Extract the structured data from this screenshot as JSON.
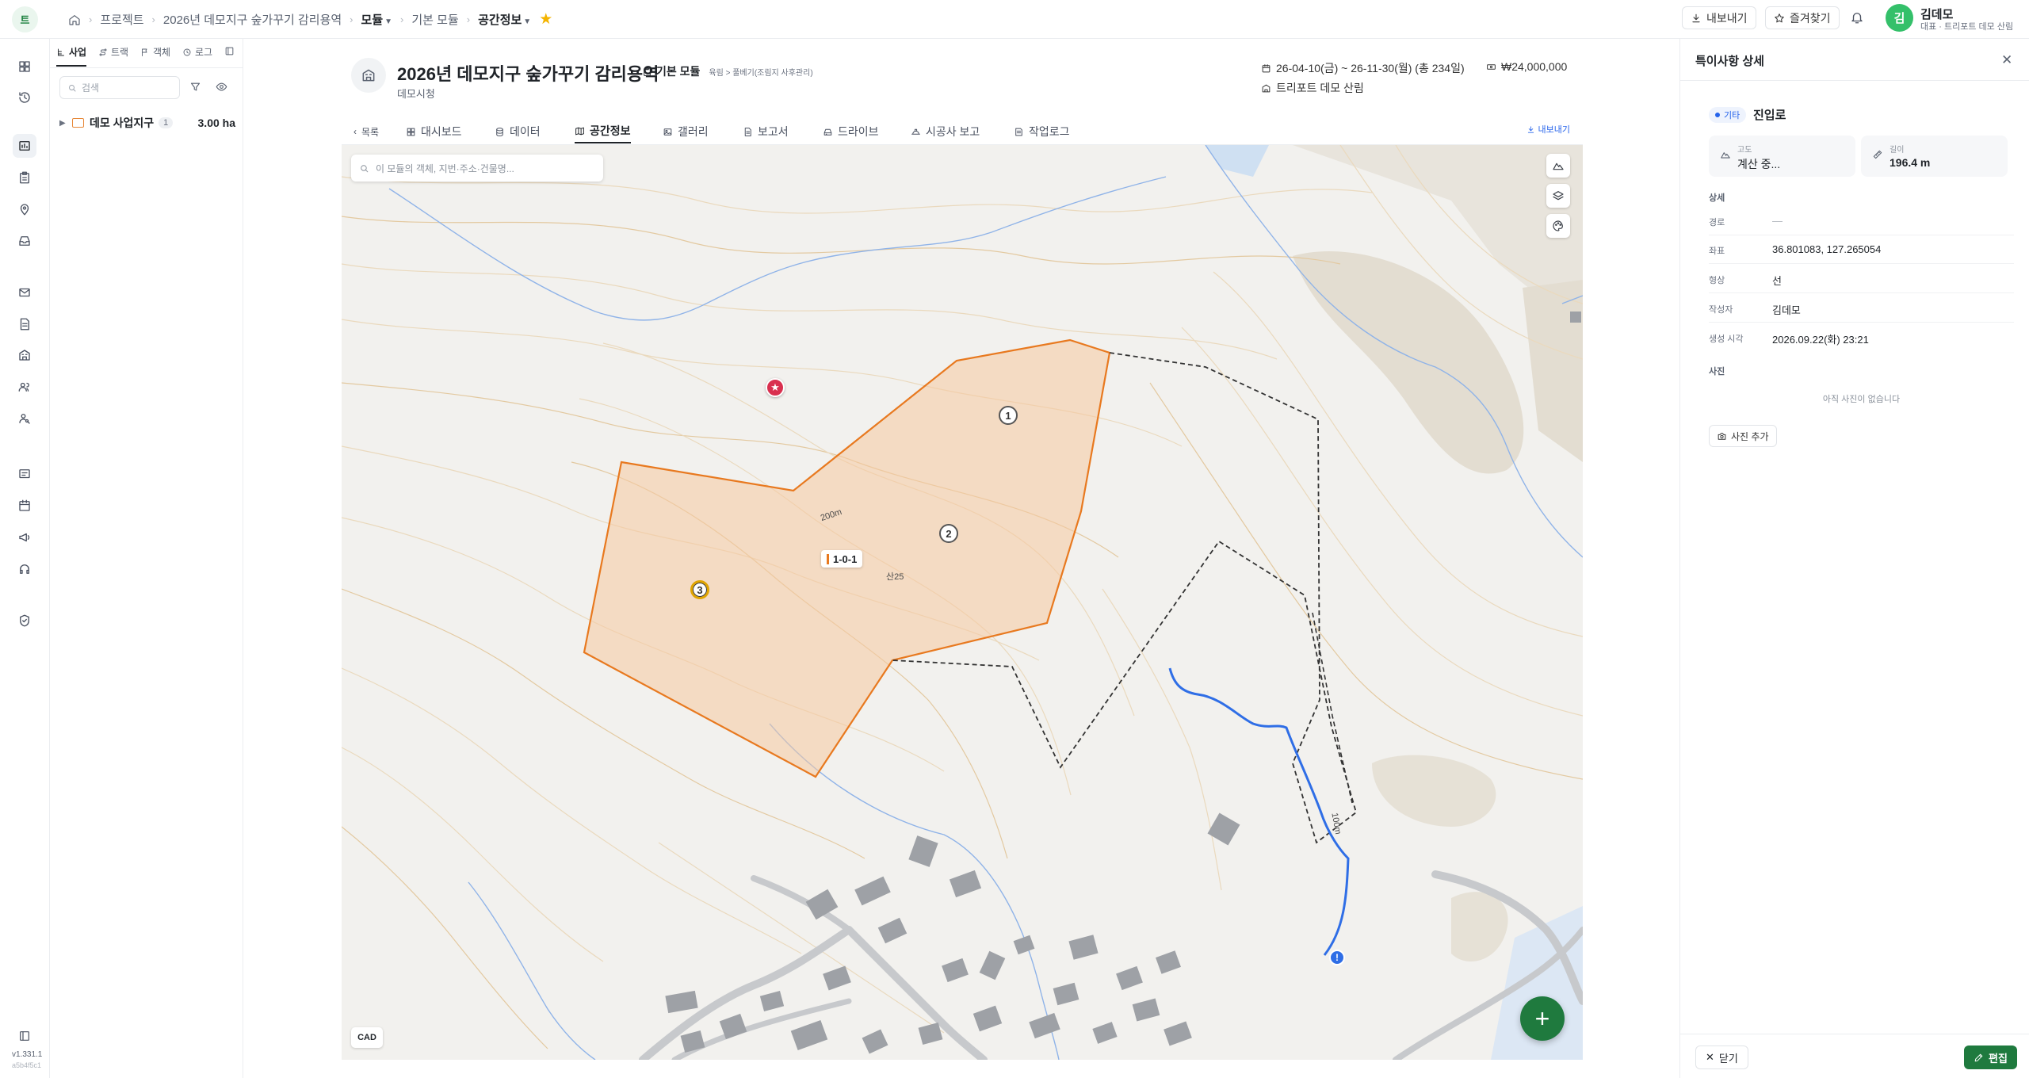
{
  "header": {
    "brand_initial": "트",
    "breadcrumb": [
      "프로젝트",
      "2026년 데모지구 숲가꾸기 감리용역",
      "모듈",
      "기본 모듈",
      "공간정보"
    ],
    "export_label": "내보내기",
    "favorites_label": "즐겨찾기",
    "user": {
      "initial": "김",
      "name": "김데모",
      "role": "대표 · 트리포트 데모 산림"
    }
  },
  "rail": {
    "version": "v1.331.1",
    "build": "a5b4f5c1"
  },
  "explorer": {
    "tabs": [
      "사업",
      "트랙",
      "객체",
      "로그"
    ],
    "search_placeholder": "검색",
    "tree": [
      {
        "name": "데모 사업지구",
        "count": "1",
        "area": "3.00 ha"
      }
    ]
  },
  "project": {
    "title": "2026년 데모지구 숲가꾸기 감리용역",
    "module_label": "기본 모듈",
    "module_path": "육림 > 풀베기(조림지 사후관리)",
    "client": "데모시청",
    "period": "26-04-10(금) ~ 26-11-30(월) (총 234일)",
    "budget": "₩24,000,000",
    "company": "트리포트 데모 산림"
  },
  "tabs": {
    "back": "목록",
    "items": [
      "대시보드",
      "데이터",
      "공간정보",
      "갤러리",
      "보고서",
      "드라이브",
      "시공사 보고",
      "작업로그"
    ],
    "active": "공간정보",
    "export": "내보내기"
  },
  "map": {
    "search_placeholder": "이 모듈의 객체, 지번·주소·건물명...",
    "parcel_label": "1-0-1",
    "parcel_lot": "산25",
    "contour_200": "200m",
    "contour_100": "100m",
    "markers": [
      "1",
      "2",
      "3"
    ],
    "star_glyph": "★",
    "info_glyph": "!",
    "cad_label": "CAD",
    "fab_glyph": "+"
  },
  "detail": {
    "title": "특이사항 상세",
    "close_glyph": "✕",
    "type_badge": "기타",
    "feature_name": "진입로",
    "elevation": {
      "label": "고도",
      "value": "계산 중..."
    },
    "length": {
      "label": "길이",
      "value": "196.4 m"
    },
    "section_detail": "상세",
    "props": [
      {
        "key": "경로",
        "value": "—"
      },
      {
        "key": "좌표",
        "value": "36.801083, 127.265054"
      },
      {
        "key": "형상",
        "value": "선"
      },
      {
        "key": "작성자",
        "value": "김데모"
      },
      {
        "key": "생성 시각",
        "value": "2026.09.22(화) 23:21"
      }
    ],
    "section_photo": "사진",
    "no_photo": "아직 사진이 없습니다",
    "add_photo": "사진 추가",
    "close_btn": "닫기",
    "edit_btn": "편집"
  },
  "colors": {
    "accent_green": "#1f7a3e",
    "parcel_fill": "#f6c9a0",
    "parcel_stroke": "#e8791f",
    "route_blue": "#2f6ee6",
    "favorite_star": "#f4b400"
  }
}
